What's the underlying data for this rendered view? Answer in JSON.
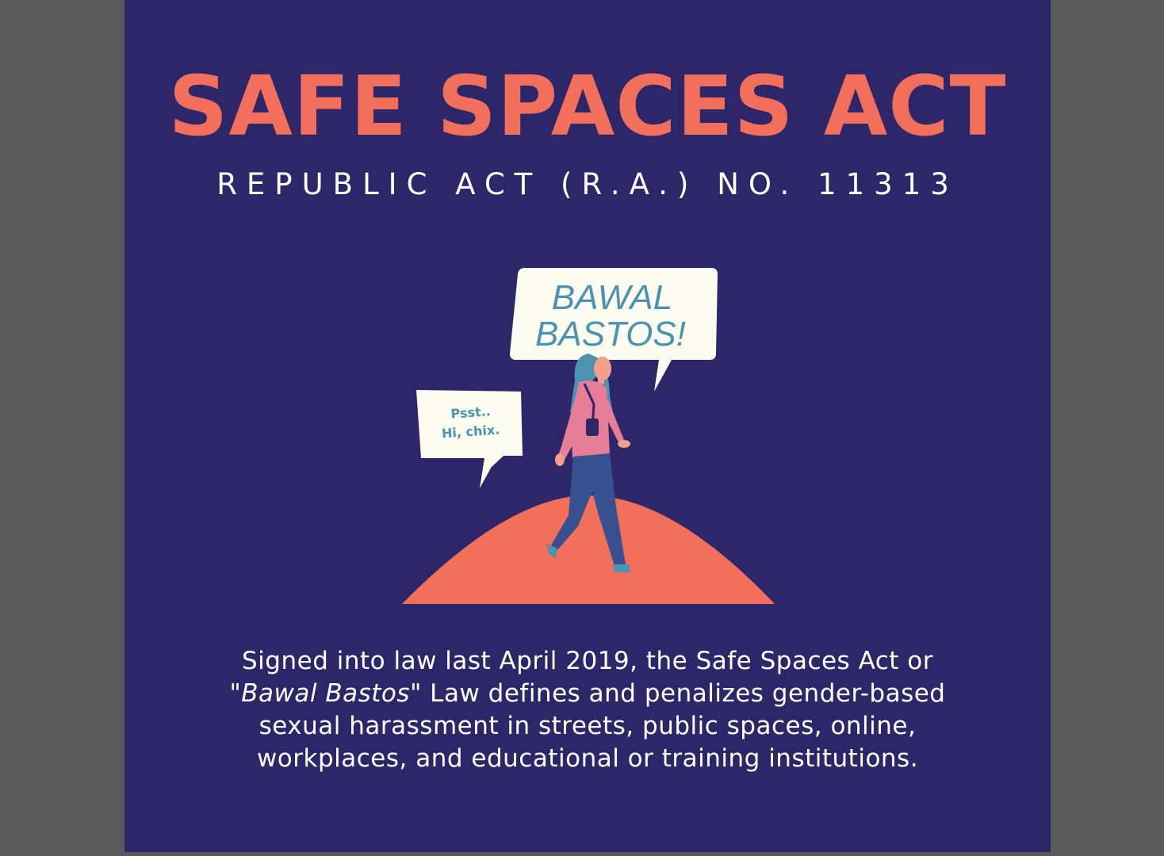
{
  "poster": {
    "title": "SAFE SPACES ACT",
    "subtitle": "REPUBLIC ACT (R.A.) NO. 11313",
    "speech_main_line1": "BAWAL",
    "speech_main_line2": "BASTOS!",
    "speech_small_line1": "Psst..",
    "speech_small_line2": "Hi, chix.",
    "body_part1": "Signed into law last April 2019, the Safe Spaces Act or \"",
    "body_italic": "Bawal Bastos",
    "body_part2": "\" Law defines and penalizes gender-based sexual harassment in streets, public spaces, online, workplaces, and educational or training institutions."
  },
  "colors": {
    "background": "#2d2769",
    "accent": "#f26f5c",
    "bubble": "#fbfbf0",
    "bubble_text": "#4b93b0",
    "outer": "#5a5a5a"
  },
  "icons": [
    "woman-walking-illustration",
    "speech-bubble-icon",
    "hill-shape"
  ]
}
